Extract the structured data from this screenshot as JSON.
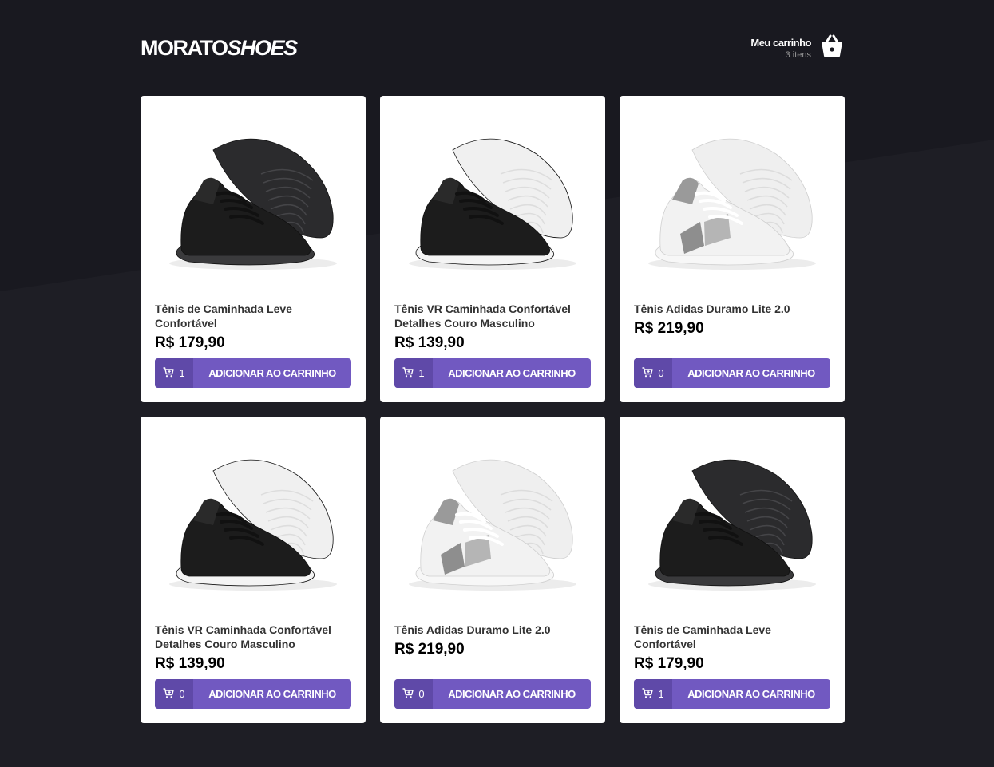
{
  "header": {
    "logo_main": "MORATO",
    "logo_italic": "SHOES",
    "cart_title": "Meu carrinho",
    "cart_count": "3 itens",
    "cart_icon": "basket-icon"
  },
  "colors": {
    "background": "#191920",
    "accent": "#7159c1",
    "accent_dark": "#5f49a8"
  },
  "products": [
    {
      "title": "Tênis de Caminhada Leve Confortável",
      "price": "R$ 179,90",
      "qty": "1",
      "button": "ADICIONAR AO CARRINHO",
      "shoe": "black-sole-dark"
    },
    {
      "title": "Tênis VR Caminhada Confortável Detalhes Couro Masculino",
      "price": "R$ 139,90",
      "qty": "1",
      "button": "ADICIONAR AO CARRINHO",
      "shoe": "black-sole-white"
    },
    {
      "title": "Tênis Adidas Duramo Lite 2.0",
      "price": "R$ 219,90",
      "qty": "0",
      "button": "ADICIONAR AO CARRINHO",
      "shoe": "white-grey"
    },
    {
      "title": "Tênis VR Caminhada Confortável Detalhes Couro Masculino",
      "price": "R$ 139,90",
      "qty": "0",
      "button": "ADICIONAR AO CARRINHO",
      "shoe": "black-sole-white"
    },
    {
      "title": "Tênis Adidas Duramo Lite 2.0",
      "price": "R$ 219,90",
      "qty": "0",
      "button": "ADICIONAR AO CARRINHO",
      "shoe": "white-grey"
    },
    {
      "title": "Tênis de Caminhada Leve Confortável",
      "price": "R$ 179,90",
      "qty": "1",
      "button": "ADICIONAR AO CARRINHO",
      "shoe": "black-sole-dark"
    }
  ]
}
